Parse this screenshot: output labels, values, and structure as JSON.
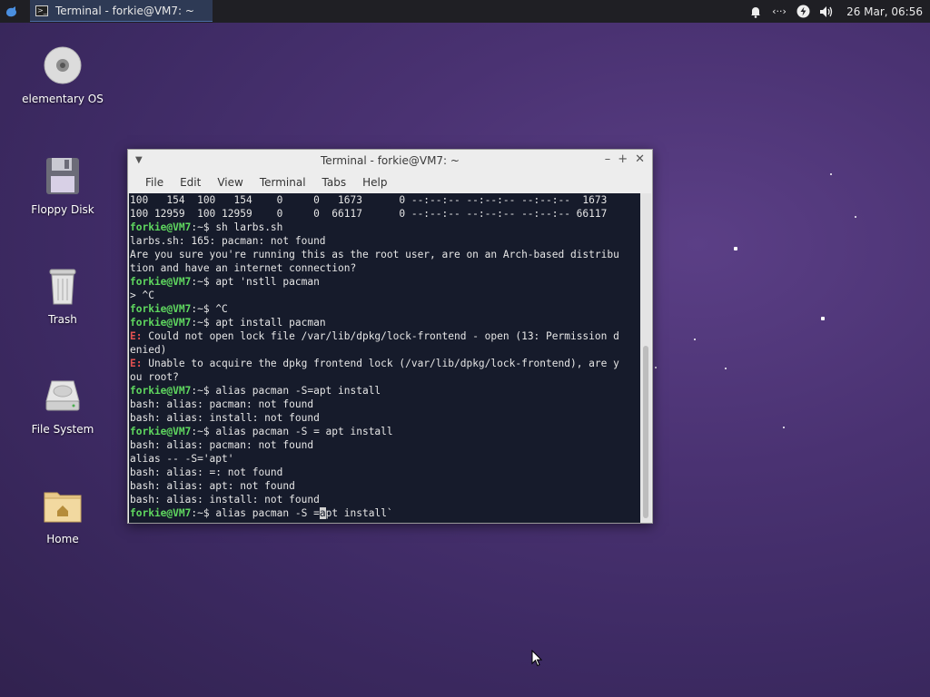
{
  "panel": {
    "task_title": "Terminal - forkie@VM7: ~",
    "clock": "26 Mar, 06:56"
  },
  "desktop_icons": [
    {
      "label": "elementary OS",
      "icon": "disc-icon"
    },
    {
      "label": "Floppy Disk",
      "icon": "floppy-icon"
    },
    {
      "label": "Trash",
      "icon": "trash-icon"
    },
    {
      "label": "File System",
      "icon": "harddrive-icon"
    },
    {
      "label": "Home",
      "icon": "home-folder-icon"
    }
  ],
  "window": {
    "title": "Terminal - forkie@VM7: ~",
    "menu": [
      "File",
      "Edit",
      "View",
      "Terminal",
      "Tabs",
      "Help"
    ]
  },
  "terminal": {
    "prompt_user": "forkie@VM7",
    "prompt_sep": ":~$ ",
    "lines": [
      {
        "t": "out",
        "text": "100   154  100   154    0     0   1673      0 --:--:-- --:--:-- --:--:--  1673"
      },
      {
        "t": "out",
        "text": "100 12959  100 12959    0     0  66117      0 --:--:-- --:--:-- --:--:-- 66117"
      },
      {
        "t": "cmd",
        "text": "sh larbs.sh"
      },
      {
        "t": "out",
        "text": "larbs.sh: 165: pacman: not found"
      },
      {
        "t": "out",
        "text": "Are you sure you're running this as the root user, are on an Arch-based distribu"
      },
      {
        "t": "out",
        "text": "tion and have an internet connection?"
      },
      {
        "t": "cmd",
        "text": "apt 'nstll pacman"
      },
      {
        "t": "out",
        "text": "> ^C"
      },
      {
        "t": "cmd",
        "text": "^C"
      },
      {
        "t": "cmd",
        "text": "apt install pacman"
      },
      {
        "t": "err",
        "tag": "E:",
        "text": " Could not open lock file /var/lib/dpkg/lock-frontend - open (13: Permission d"
      },
      {
        "t": "out",
        "text": "enied)"
      },
      {
        "t": "err",
        "tag": "E:",
        "text": " Unable to acquire the dpkg frontend lock (/var/lib/dpkg/lock-frontend), are y"
      },
      {
        "t": "out",
        "text": "ou root?"
      },
      {
        "t": "cmd",
        "text": "alias pacman -S=apt install"
      },
      {
        "t": "out",
        "text": "bash: alias: pacman: not found"
      },
      {
        "t": "out",
        "text": "bash: alias: install: not found"
      },
      {
        "t": "cmd",
        "text": "alias pacman -S = apt install"
      },
      {
        "t": "out",
        "text": "bash: alias: pacman: not found"
      },
      {
        "t": "out",
        "text": "alias -- -S='apt'"
      },
      {
        "t": "out",
        "text": "bash: alias: =: not found"
      },
      {
        "t": "out",
        "text": "bash: alias: apt: not found"
      },
      {
        "t": "out",
        "text": "bash: alias: install: not found"
      }
    ],
    "current_input_before": "alias pacman -S =",
    "current_input_cursor": "a",
    "current_input_after": "pt install`"
  }
}
